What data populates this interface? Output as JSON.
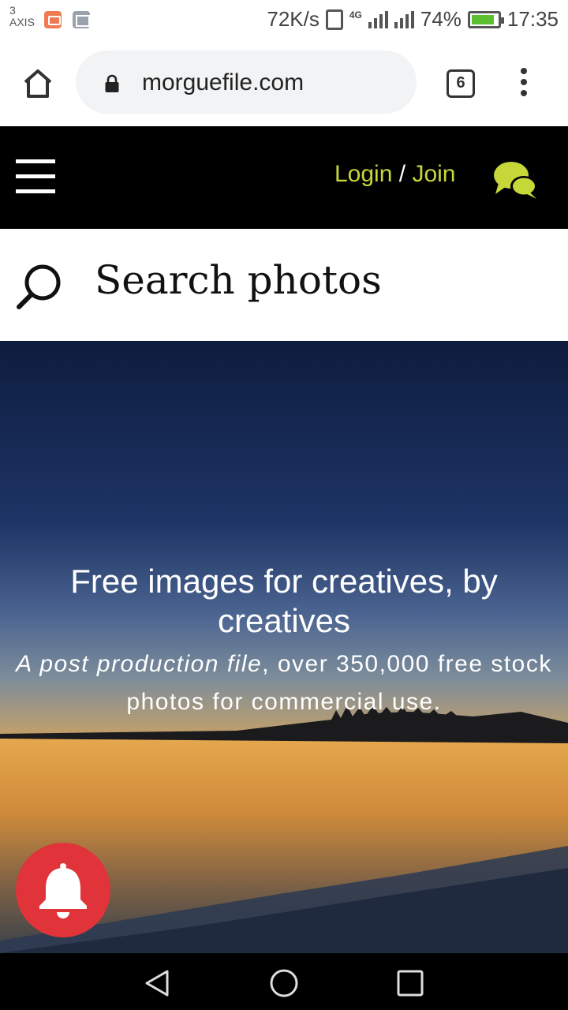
{
  "status_bar": {
    "carrier_line1": "3",
    "carrier_line2": "AXIS",
    "speed": "72K/s",
    "network": "4G",
    "battery": "74%",
    "time": "17:35"
  },
  "browser": {
    "url": "morguefile.com",
    "tab_count": "6"
  },
  "site_header": {
    "login": "Login",
    "separator": "/",
    "join": "Join",
    "accent_color": "#c6d73a"
  },
  "search": {
    "placeholder": "Search photos"
  },
  "hero": {
    "title": "Free images for creatives, by creatives",
    "subtitle_italic": "A post production file",
    "subtitle_rest": ", over 350,000 free stock photos for commercial use."
  },
  "notification_button": {
    "icon": "bell-icon",
    "color": "#e0343a"
  },
  "nav_bar": {
    "back_icon": "back-triangle-icon",
    "home_icon": "home-circle-icon",
    "recent_icon": "recents-square-icon"
  }
}
